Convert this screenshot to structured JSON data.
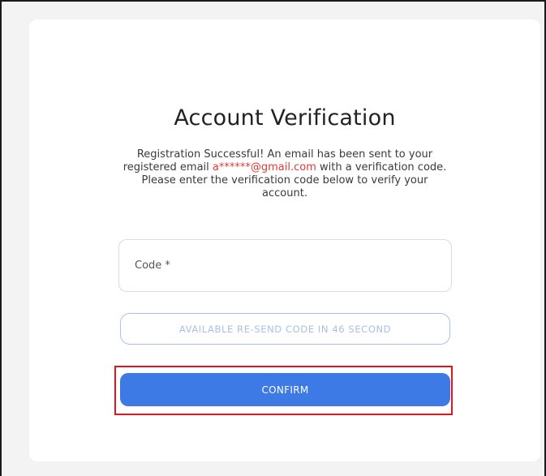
{
  "page": {
    "title": "Account Verification",
    "message_before_email": "Registration Successful! An email has been sent to your registered email ",
    "email": "a******@gmail.com",
    "message_after_email": " with a verification code. Please enter the verification code below to verify your account."
  },
  "form": {
    "code_placeholder": "Code *",
    "code_value": "",
    "resend_label": "AVAILABLE RE-SEND CODE IN 46 SECOND",
    "confirm_label": "CONFIRM"
  },
  "colors": {
    "email_text": "#e53935",
    "primary_button": "#3e7ae6",
    "highlight_border": "#e0161e"
  }
}
